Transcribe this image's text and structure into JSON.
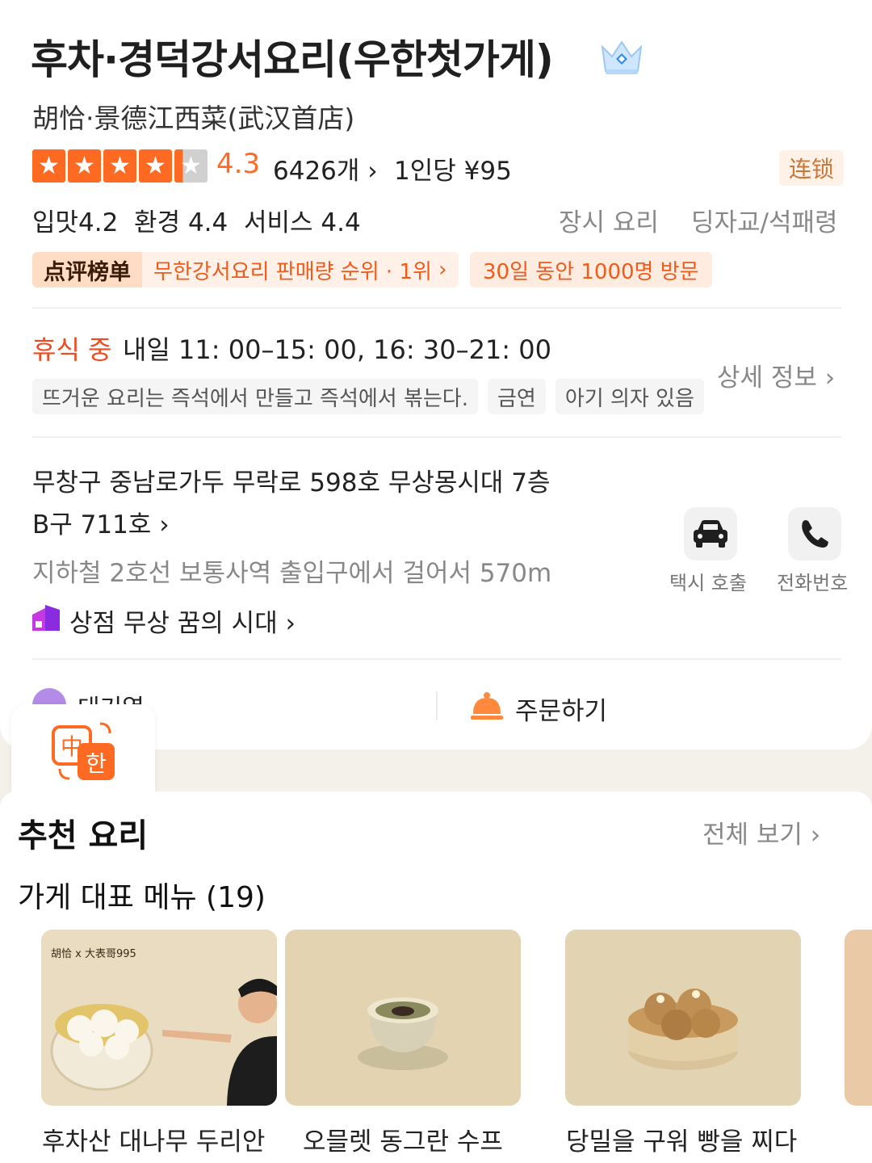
{
  "store": {
    "name_ko": "후차·경덕강서요리(우한첫가게)",
    "name_zh": "胡恰·景德江西菜(武汉首店)",
    "crown_icon": "crown-diamond-icon",
    "rating_value": "4.3",
    "rating_stars": 4.3,
    "reviews": "6426개",
    "price": "1인당 ¥95",
    "chain_badge": "连锁",
    "scores": "입맛4.2  환경 4.4  서비스 4.4",
    "category": "장시 요리",
    "area": "딩자교/석패령",
    "rank_logo": "点评榜单",
    "rank_text": "무한강서요리 판매량 순위 · 1위",
    "visits": "30일 동안 1000명 방문"
  },
  "hours": {
    "status": "휴식 중",
    "text": "내일 11: 00–15: 00, 16: 30–21: 00",
    "tags": [
      "뜨거운 요리는 즉석에서 만들고 즉석에서 볶는다.",
      "금연",
      "아기 의자 있음"
    ],
    "detail_link": "상세 정보"
  },
  "address": {
    "line1": "무창구 중남로가두 무락로 598호 무상몽시대 7층",
    "line2": "B구 711호",
    "subway": "지하철 2호선 보통사역 출입구에서 걸어서 570m",
    "mall": "상점 무상 꿈의 시대"
  },
  "actions": {
    "taxi": "택시 호출",
    "phone": "전화번호"
  },
  "bottom_bar": {
    "queue": "대기열",
    "order": "주문하기"
  },
  "translate": {
    "zh": "中",
    "ko": "한"
  },
  "recommend": {
    "title": "추천 요리",
    "see_all": "전체 보기",
    "menu_title": "가게 대표 메뉴 (19)",
    "dishes": [
      {
        "name": "후차산 대나무 두리안",
        "brand": "胡恰 x 大表哥995"
      },
      {
        "name": "오믈렛 동그란 수프"
      },
      {
        "name": "당밀을 구워 빵을 찌다"
      }
    ]
  },
  "colors": {
    "accent": "#ff6a22",
    "status": "#f04a1f",
    "muted": "#888888"
  }
}
